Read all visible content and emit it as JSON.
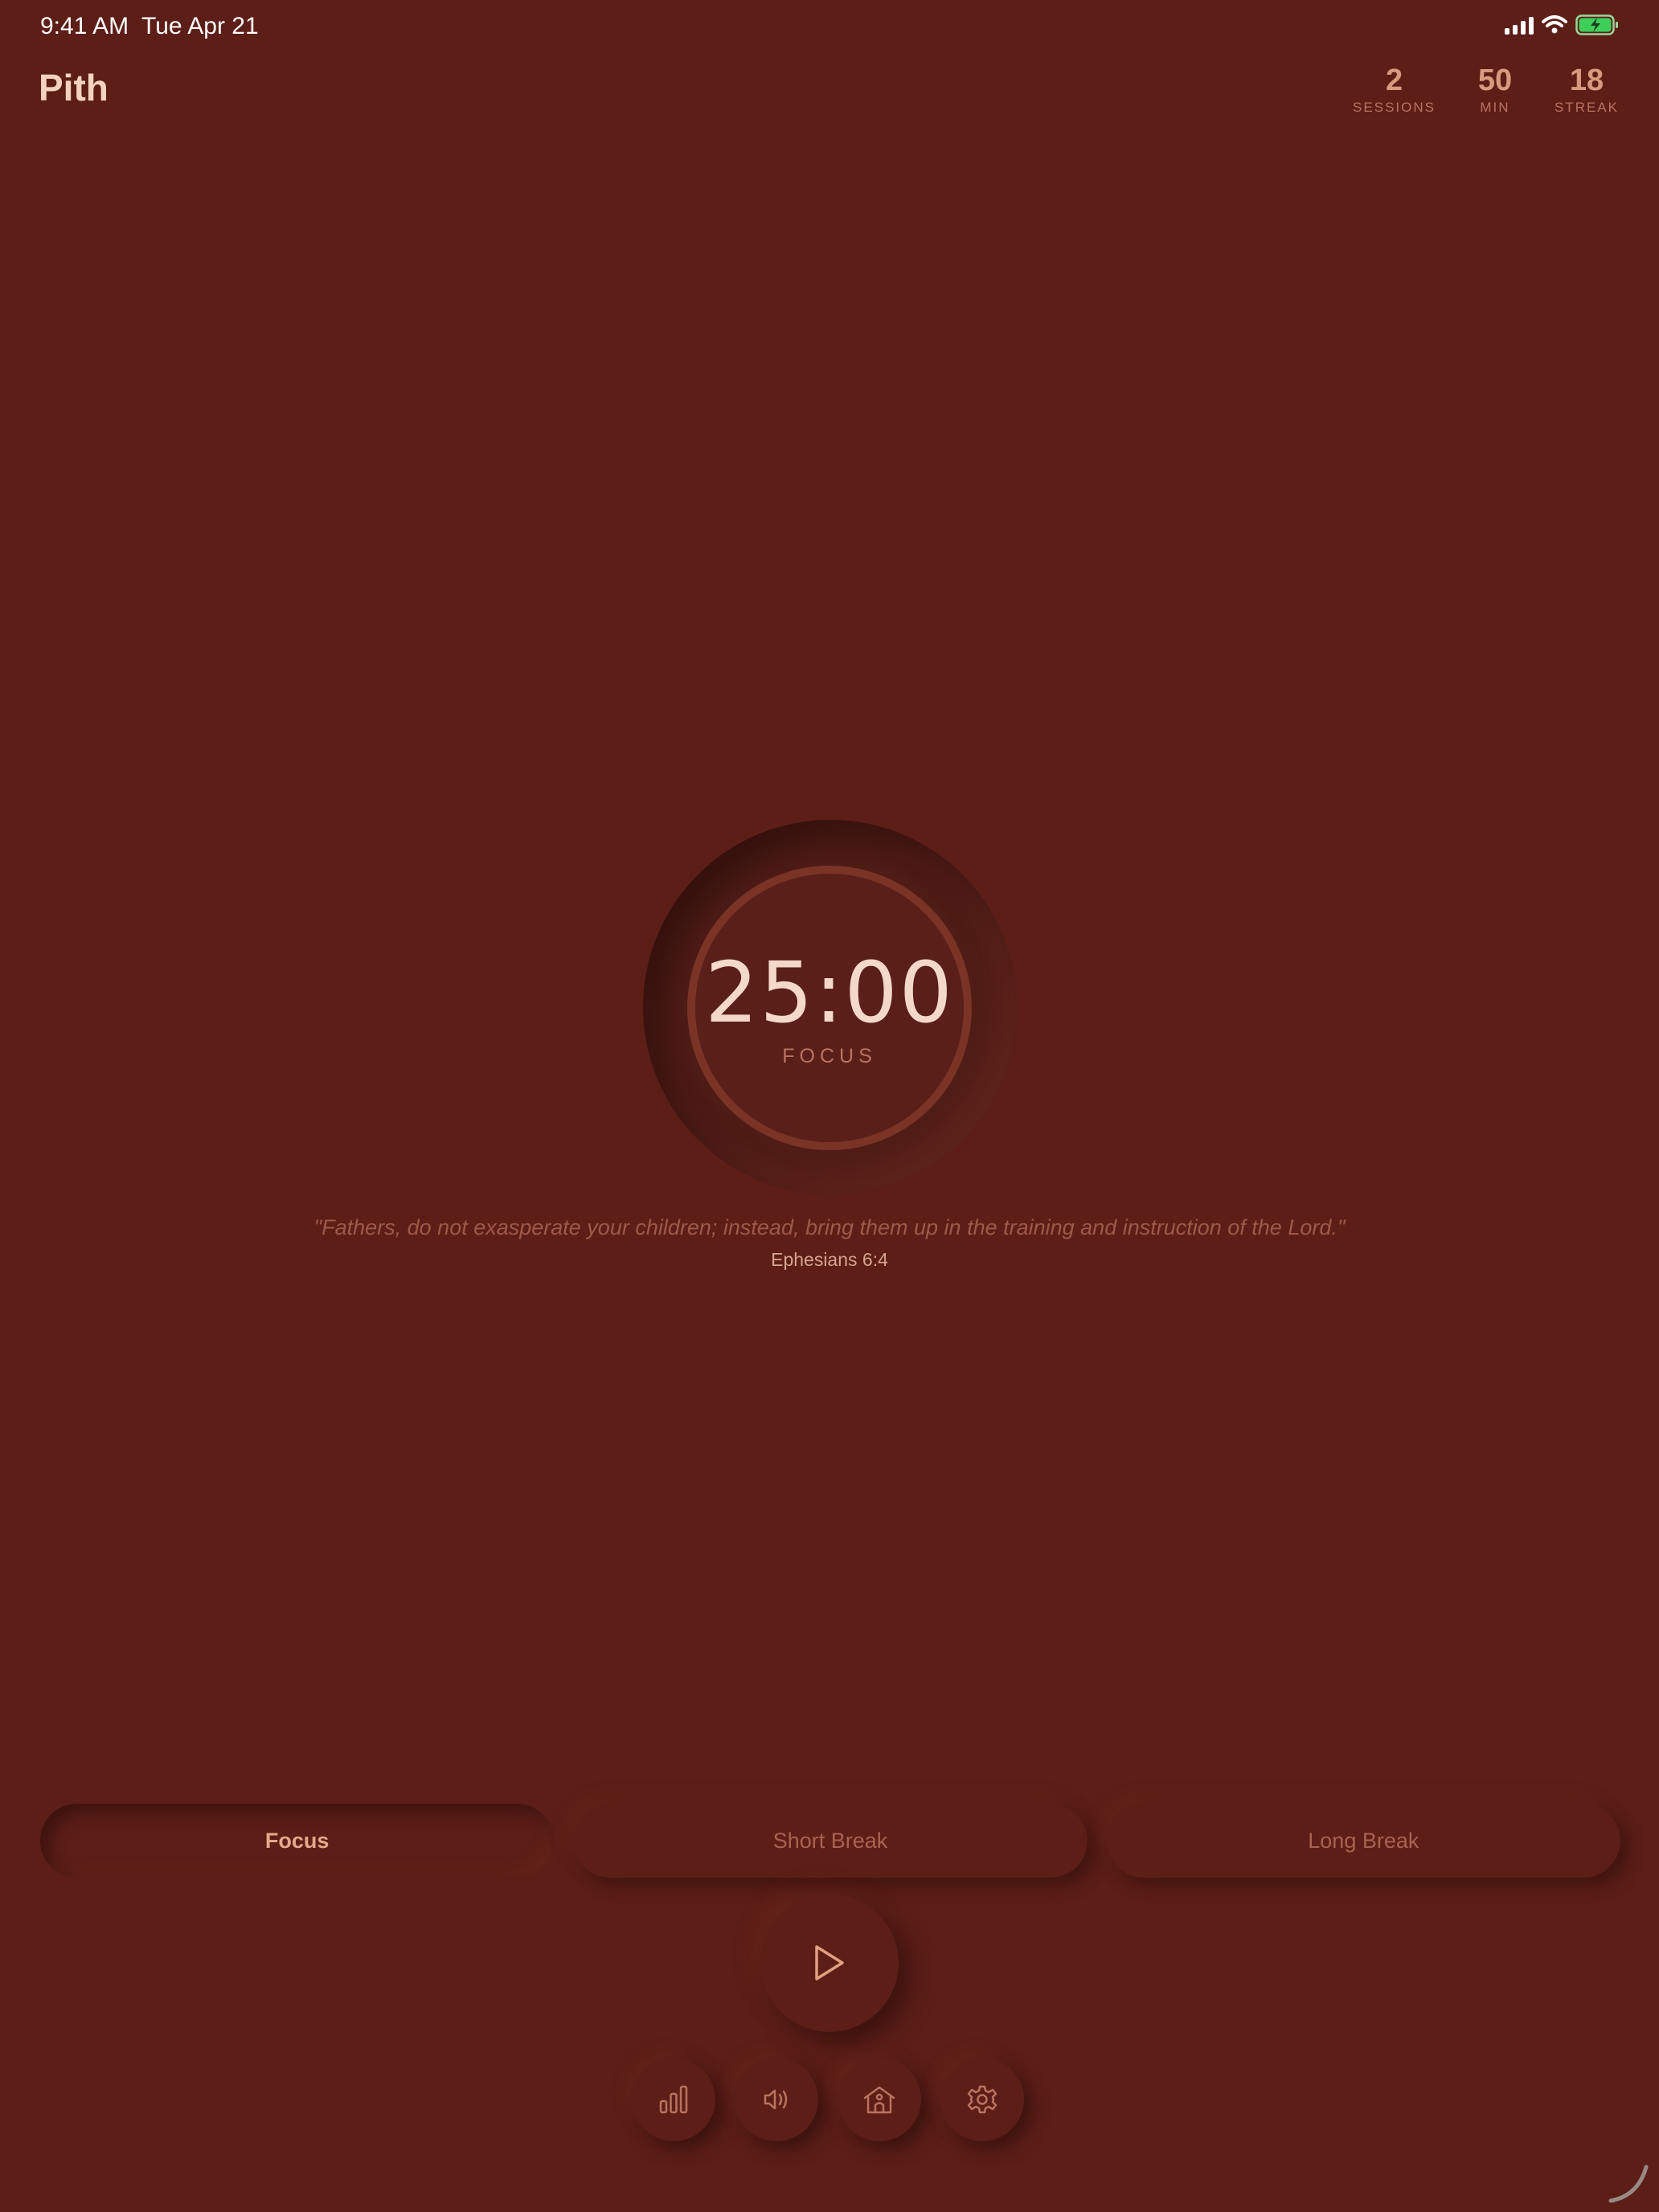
{
  "status_bar": {
    "time": "9:41 AM",
    "date": "Tue Apr 21",
    "icons": [
      "signal-icon",
      "wifi-icon",
      "battery-charging-icon"
    ]
  },
  "header": {
    "title": "Pith",
    "stats": [
      {
        "value": "2",
        "label": "SESSIONS"
      },
      {
        "value": "50",
        "label": "MIN"
      },
      {
        "value": "18",
        "label": "STREAK"
      }
    ]
  },
  "timer": {
    "time": "25:00",
    "mode": "FOCUS"
  },
  "quote": {
    "text": "\"Fathers, do not exasperate your children; instead, bring them up in the training and instruction of the Lord.\"",
    "reference": "Ephesians 6:4"
  },
  "modes": {
    "tabs": [
      {
        "label": "Focus",
        "active": true
      },
      {
        "label": "Short Break",
        "active": false
      },
      {
        "label": "Long Break",
        "active": false
      }
    ]
  },
  "controls": {
    "play_icon": "play-icon",
    "bottom_icons": [
      "stats-icon",
      "sound-icon",
      "church-icon",
      "gear-icon"
    ]
  },
  "colors": {
    "background": "#5c1e17",
    "ring": "#7a3325",
    "accent_text": "#d89a7e"
  }
}
